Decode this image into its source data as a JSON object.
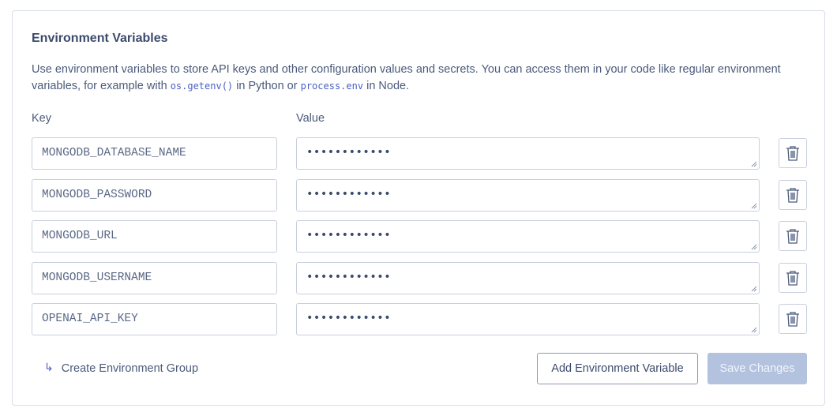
{
  "section": {
    "title": "Environment Variables",
    "description_1": "Use environment variables to store API keys and other configuration values and secrets. You can access them in your code like regular environment variables, for example with ",
    "code_1": "os.getenv()",
    "description_2": " in Python or ",
    "code_2": "process.env",
    "description_3": " in Node."
  },
  "columns": {
    "key": "Key",
    "value": "Value"
  },
  "variables": [
    {
      "key": "MONGODB_DATABASE_NAME",
      "value": "••••••••••••"
    },
    {
      "key": "MONGODB_PASSWORD",
      "value": "••••••••••••"
    },
    {
      "key": "MONGODB_URL",
      "value": "••••••••••••"
    },
    {
      "key": "MONGODB_USERNAME",
      "value": "••••••••••••"
    },
    {
      "key": "OPENAI_API_KEY",
      "value": "••••••••••••"
    }
  ],
  "footer": {
    "create_group_label": "Create Environment Group",
    "add_variable_label": "Add Environment Variable",
    "save_label": "Save Changes"
  },
  "icons": {
    "delete": "trash-icon",
    "create_group": "arrow-return-right-icon"
  },
  "colors": {
    "accent": "#4a5fc1",
    "save_disabled": "#b3c2df"
  }
}
